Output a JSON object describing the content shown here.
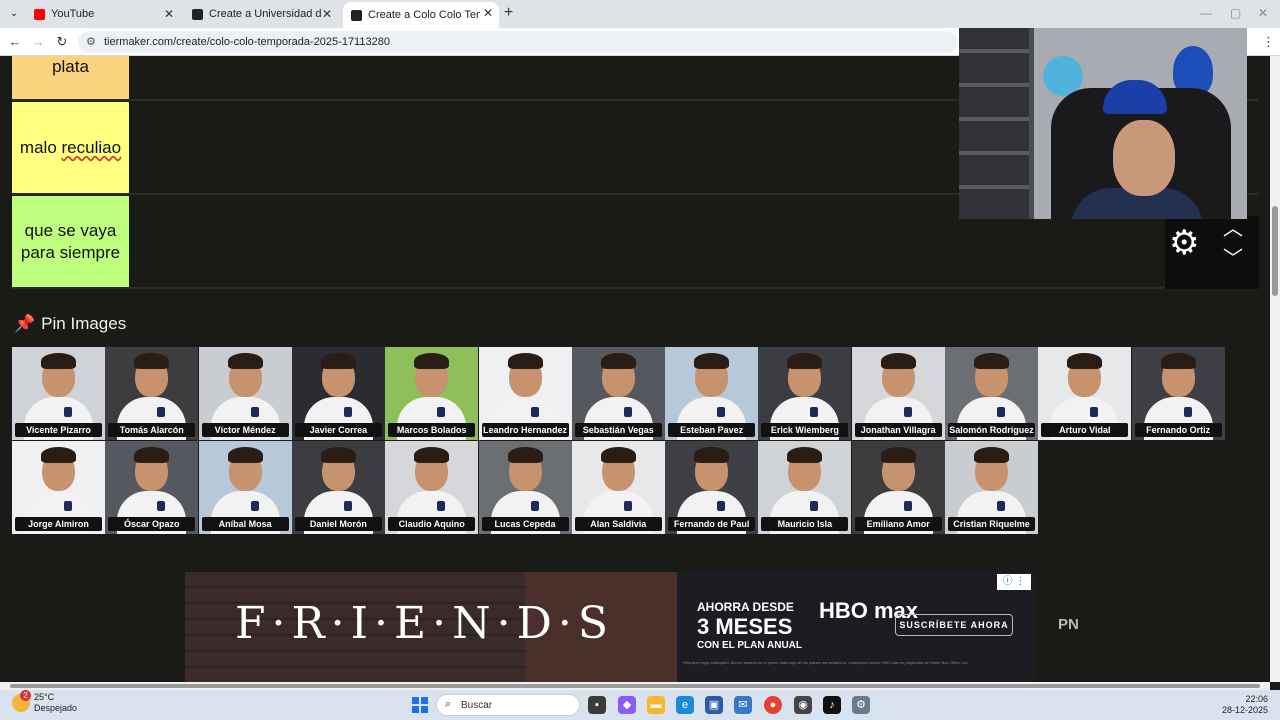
{
  "browser": {
    "tabs": [
      {
        "title": "YouTube",
        "active": false,
        "favicon_color": "#ff0000"
      },
      {
        "title": "Create a Universidad de Chile Ti",
        "active": false,
        "favicon_color": "#222222"
      },
      {
        "title": "Create a Colo Colo Temporada",
        "active": true,
        "favicon_color": "#222222"
      }
    ],
    "url": "tiermaker.com/create/colo-colo-temporada-2025-17113280"
  },
  "tiers": [
    {
      "label": "plata",
      "color": "#fad47e"
    },
    {
      "label": "malo reculiao",
      "color": "#ffff7f"
    },
    {
      "label_line1": "que se vaya",
      "label_line2": "para siempre",
      "color": "#bfff7f"
    }
  ],
  "pin_images": {
    "heading": "Pin Images",
    "row1": [
      {
        "name": "Vicente Pizarro"
      },
      {
        "name": "Tomás Alarcón"
      },
      {
        "name": "Víctor Méndez"
      },
      {
        "name": "Javier Correa"
      },
      {
        "name": "Marcos Bolados"
      },
      {
        "name": "Leandro Hernandez"
      },
      {
        "name": "Sebastián Vegas"
      },
      {
        "name": "Esteban Pavez"
      },
      {
        "name": "Erick Wiemberg"
      },
      {
        "name": "Jonathan Villagra"
      },
      {
        "name": "Salomón Rodríguez"
      },
      {
        "name": "Arturo Vidal"
      },
      {
        "name": "Fernando Ortiz"
      }
    ],
    "row2": [
      {
        "name": "Jorge Almiron"
      },
      {
        "name": "Óscar Opazo"
      },
      {
        "name": "Aníbal Mosa"
      },
      {
        "name": "Daniel Morón"
      },
      {
        "name": "Claudio Aquino"
      },
      {
        "name": "Lucas Cepeda"
      },
      {
        "name": "Alan Saldivia"
      },
      {
        "name": "Fernando de Paul"
      },
      {
        "name": "Mauricio Isla"
      },
      {
        "name": "Emiliano Amor"
      },
      {
        "name": "Cristian Riquelme"
      }
    ]
  },
  "ad": {
    "friends_text": "F·R·I·E·N·D·S",
    "ahorra": "AHORRA DESDE",
    "meses": "3 MESES",
    "plan": "CON EL PLAN ANUAL",
    "brand": "HBO max",
    "cta": "SUSCRÍBETE AHORA",
    "fineprint": "Requiere pago anticipado. Ahorro basado en el precio más bajo de los planes mensuales vs. suscripción anual. HBO Max es propiedad de Home Box Office, Inc."
  },
  "pn_text": "PN",
  "taskbar": {
    "temp": "25°C",
    "weather": "Despejado",
    "weather_badge": "2",
    "search_label": "Buscar",
    "time": "22:06",
    "date": "28-12-2025"
  }
}
